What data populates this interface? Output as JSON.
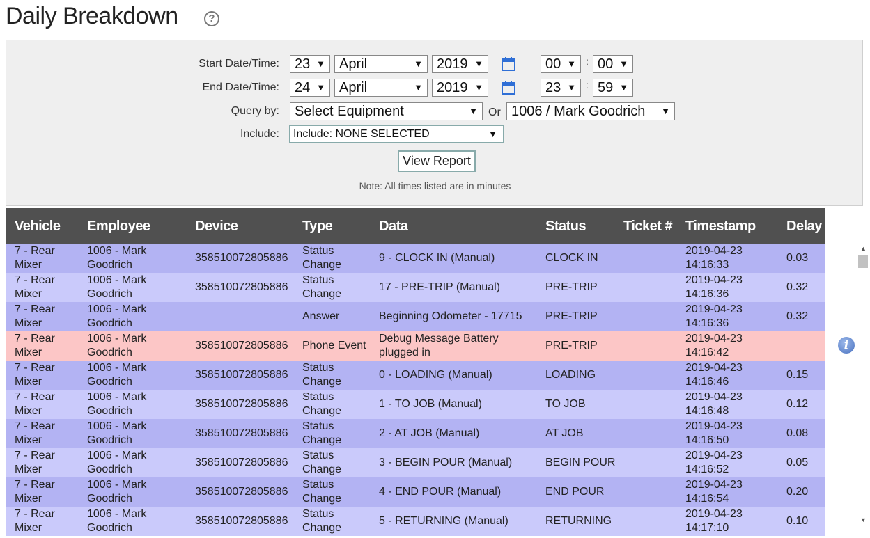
{
  "page": {
    "title": "Daily Breakdown",
    "help_glyph": "?"
  },
  "filters": {
    "start_label": "Start Date/Time:",
    "start": {
      "day": "23",
      "month": "April",
      "year": "2019",
      "hour": "00",
      "minute": "00"
    },
    "end_label": "End Date/Time:",
    "end": {
      "day": "24",
      "month": "April",
      "year": "2019",
      "hour": "23",
      "minute": "59"
    },
    "colon": ":",
    "query_label": "Query by:",
    "equipment": "Select Equipment",
    "or_label": "Or",
    "employee": "1006 / Mark Goodrich",
    "include_label": "Include:",
    "include": "Include: NONE SELECTED",
    "view_button": "View Report",
    "note": "Note: All times listed are in minutes",
    "arrow": "▼"
  },
  "table": {
    "headers": [
      "Vehicle",
      "Employee",
      "Device",
      "Type",
      "Data",
      "Status",
      "Ticket #",
      "Timestamp",
      "Delay"
    ],
    "rows": [
      {
        "vehicle": "7 - Rear Mixer",
        "employee": "1006 - Mark Goodrich",
        "device": "358510072805886",
        "type": "Status Change",
        "data": "9 - CLOCK IN (Manual)",
        "status": "CLOCK IN",
        "ticket": "",
        "timestamp": "2019-04-23 14:16:33",
        "delay": "0.03"
      },
      {
        "vehicle": "7 - Rear Mixer",
        "employee": "1006 - Mark Goodrich",
        "device": "358510072805886",
        "type": "Status Change",
        "data": "17 - PRE-TRIP (Manual)",
        "status": "PRE-TRIP",
        "ticket": "",
        "timestamp": "2019-04-23 14:16:36",
        "delay": "0.32"
      },
      {
        "vehicle": "7 - Rear Mixer",
        "employee": "1006 - Mark Goodrich",
        "device": "",
        "type": "Answer",
        "data": "Beginning Odometer - 17715",
        "status": "PRE-TRIP",
        "ticket": "",
        "timestamp": "2019-04-23 14:16:36",
        "delay": "0.32"
      },
      {
        "vehicle": "7 - Rear Mixer",
        "employee": "1006 - Mark Goodrich",
        "device": "358510072805886",
        "type": "Phone Event",
        "data": "Debug Message Battery plugged in",
        "status": "PRE-TRIP",
        "ticket": "",
        "timestamp": "2019-04-23 14:16:42",
        "delay": ""
      },
      {
        "vehicle": "7 - Rear Mixer",
        "employee": "1006 - Mark Goodrich",
        "device": "358510072805886",
        "type": "Status Change",
        "data": "0 - LOADING (Manual)",
        "status": "LOADING",
        "ticket": "",
        "timestamp": "2019-04-23 14:16:46",
        "delay": "0.15"
      },
      {
        "vehicle": "7 - Rear Mixer",
        "employee": "1006 - Mark Goodrich",
        "device": "358510072805886",
        "type": "Status Change",
        "data": "1 - TO JOB (Manual)",
        "status": "TO JOB",
        "ticket": "",
        "timestamp": "2019-04-23 14:16:48",
        "delay": "0.12"
      },
      {
        "vehicle": "7 - Rear Mixer",
        "employee": "1006 - Mark Goodrich",
        "device": "358510072805886",
        "type": "Status Change",
        "data": "2 - AT JOB (Manual)",
        "status": "AT JOB",
        "ticket": "",
        "timestamp": "2019-04-23 14:16:50",
        "delay": "0.08"
      },
      {
        "vehicle": "7 - Rear Mixer",
        "employee": "1006 - Mark Goodrich",
        "device": "358510072805886",
        "type": "Status Change",
        "data": "3 - BEGIN POUR (Manual)",
        "status": "BEGIN POUR",
        "ticket": "",
        "timestamp": "2019-04-23 14:16:52",
        "delay": "0.05"
      },
      {
        "vehicle": "7 - Rear Mixer",
        "employee": "1006 - Mark Goodrich",
        "device": "358510072805886",
        "type": "Status Change",
        "data": "4 - END POUR (Manual)",
        "status": "END POUR",
        "ticket": "",
        "timestamp": "2019-04-23 14:16:54",
        "delay": "0.20"
      },
      {
        "vehicle": "7 - Rear Mixer",
        "employee": "1006 - Mark Goodrich",
        "device": "358510072805886",
        "type": "Status Change",
        "data": "5 - RETURNING (Manual)",
        "status": "RETURNING",
        "ticket": "",
        "timestamp": "2019-04-23 14:17:10",
        "delay": "0.10"
      }
    ],
    "row_colors": {
      "status": "#b3b3f3",
      "alt": "#cacafb",
      "phone": "#fcc6c6",
      "header": "#505050"
    }
  },
  "icons": {
    "help": "help-circle-icon",
    "calendar": "calendar-icon",
    "info": "info-icon"
  },
  "info_glyph": "i"
}
